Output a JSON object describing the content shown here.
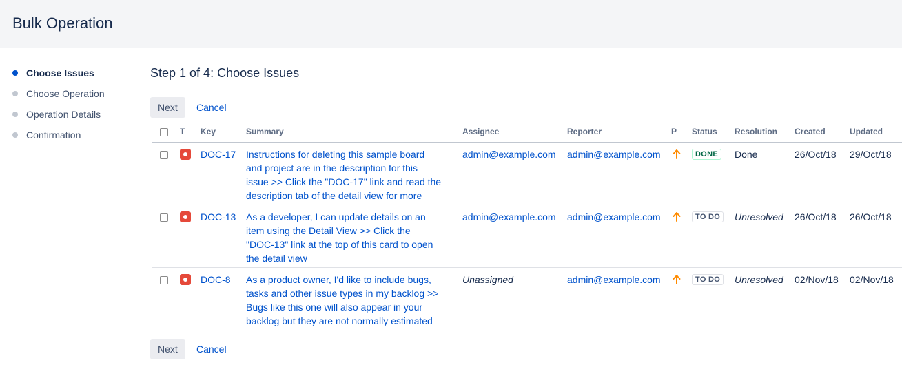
{
  "header": {
    "title": "Bulk Operation"
  },
  "steps": [
    {
      "label": "Choose Issues",
      "active": true
    },
    {
      "label": "Choose Operation",
      "active": false
    },
    {
      "label": "Operation Details",
      "active": false
    },
    {
      "label": "Confirmation",
      "active": false
    }
  ],
  "main": {
    "heading": "Step 1 of 4: Choose Issues",
    "next_label": "Next",
    "cancel_label": "Cancel"
  },
  "table": {
    "columns": {
      "t": "T",
      "key": "Key",
      "summary": "Summary",
      "assignee": "Assignee",
      "reporter": "Reporter",
      "p": "P",
      "status": "Status",
      "resolution": "Resolution",
      "created": "Created",
      "updated": "Updated"
    },
    "rows": [
      {
        "key": "DOC-17",
        "summary": [
          "Instructions for deleting this sample board",
          "and project are in the description for this",
          "issue >> Click the \"DOC-17\" link and read the",
          "description tab of the detail view for more"
        ],
        "assignee": "admin@example.com",
        "reporter": "admin@example.com",
        "status": "DONE",
        "resolution": "Done",
        "created": "26/Oct/18",
        "updated": "29/Oct/18"
      },
      {
        "key": "DOC-13",
        "summary": [
          "As a developer, I can update details on an",
          "item using the Detail View >> Click the",
          "\"DOC-13\" link at the top of this card to open",
          "the detail view"
        ],
        "assignee": "admin@example.com",
        "reporter": "admin@example.com",
        "status": "TO DO",
        "resolution": "Unresolved",
        "created": "26/Oct/18",
        "updated": "26/Oct/18"
      },
      {
        "key": "DOC-8",
        "summary": [
          "As a product owner, I'd like to include bugs,",
          "tasks and other issue types in my backlog >>",
          "Bugs like this one will also appear in your",
          "backlog but they are not normally estimated"
        ],
        "assignee": "Unassigned",
        "reporter": "admin@example.com",
        "status": "TO DO",
        "resolution": "Unresolved",
        "created": "02/Nov/18",
        "updated": "02/Nov/18"
      }
    ]
  },
  "colors": {
    "accent": "#0052cc",
    "bug": "#e5493a",
    "priority": "#ff8b00",
    "done": "#006644"
  },
  "icons": {
    "type": "bug-icon",
    "priority": "priority-high-arrow-icon"
  }
}
